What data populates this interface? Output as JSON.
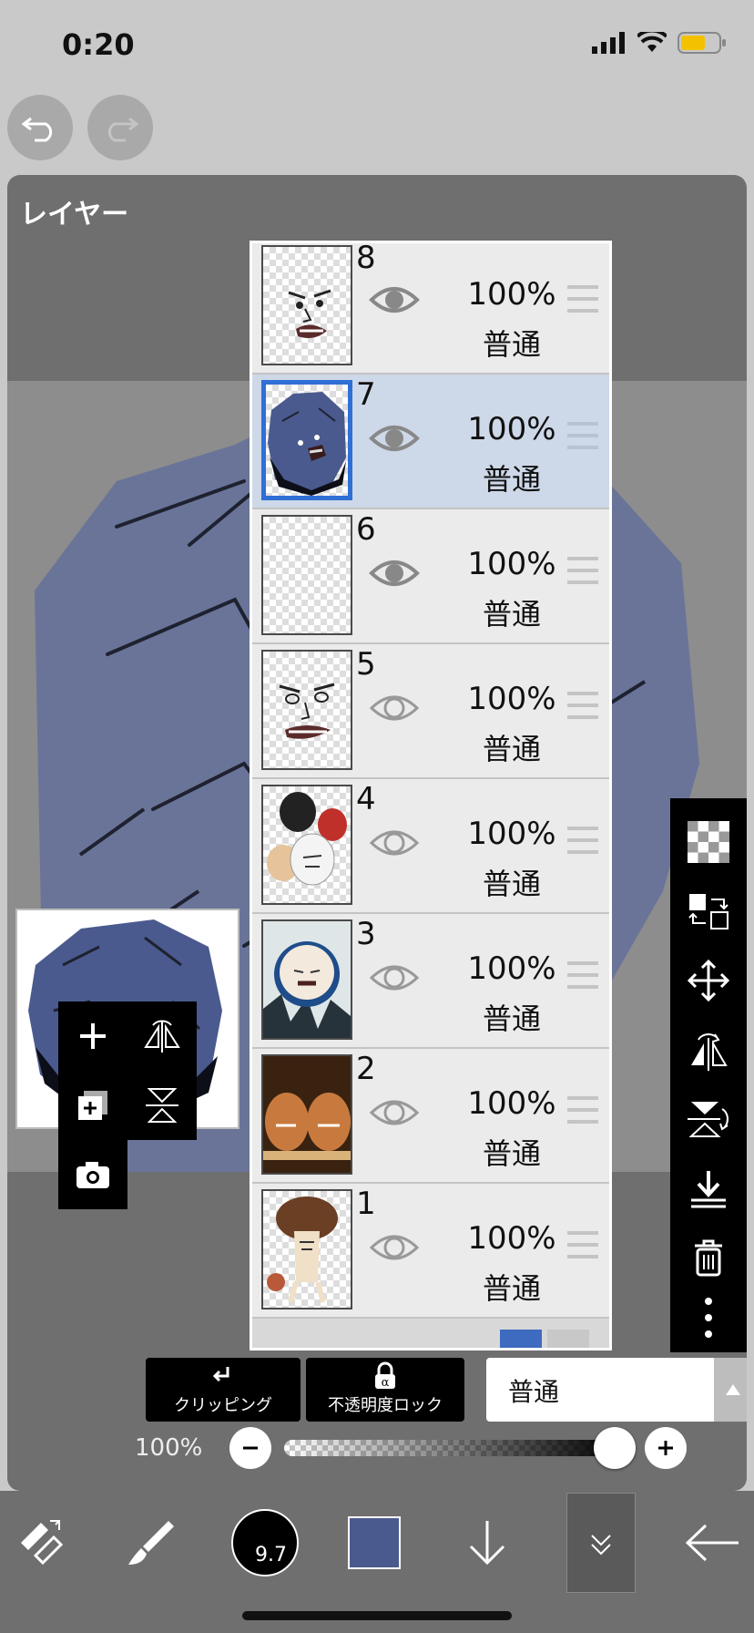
{
  "status": {
    "time": "0:20"
  },
  "panel": {
    "title": "レイヤー"
  },
  "layers": [
    {
      "num": "8",
      "opacity": "100%",
      "blend": "普通",
      "visible": true,
      "selected": false
    },
    {
      "num": "7",
      "opacity": "100%",
      "blend": "普通",
      "visible": true,
      "selected": true
    },
    {
      "num": "6",
      "opacity": "100%",
      "blend": "普通",
      "visible": true,
      "selected": false
    },
    {
      "num": "5",
      "opacity": "100%",
      "blend": "普通",
      "visible": false,
      "selected": false
    },
    {
      "num": "4",
      "opacity": "100%",
      "blend": "普通",
      "visible": false,
      "selected": false
    },
    {
      "num": "3",
      "opacity": "100%",
      "blend": "普通",
      "visible": false,
      "selected": false
    },
    {
      "num": "2",
      "opacity": "100%",
      "blend": "普通",
      "visible": false,
      "selected": false
    },
    {
      "num": "1",
      "opacity": "100%",
      "blend": "普通",
      "visible": false,
      "selected": false
    }
  ],
  "controls": {
    "clipping_label": "クリッピング",
    "alpha_lock_label": "不透明度ロック",
    "blend_mode": "普通",
    "opacity_label": "100%",
    "opacity_value": 1.0
  },
  "toolbar": {
    "brush_size": "9.7",
    "current_color": "#4a5a8e"
  },
  "colors": {
    "selection": "#2f6fd6",
    "selected_row": "#cdd8e8",
    "rock": "#4a5a8e"
  }
}
